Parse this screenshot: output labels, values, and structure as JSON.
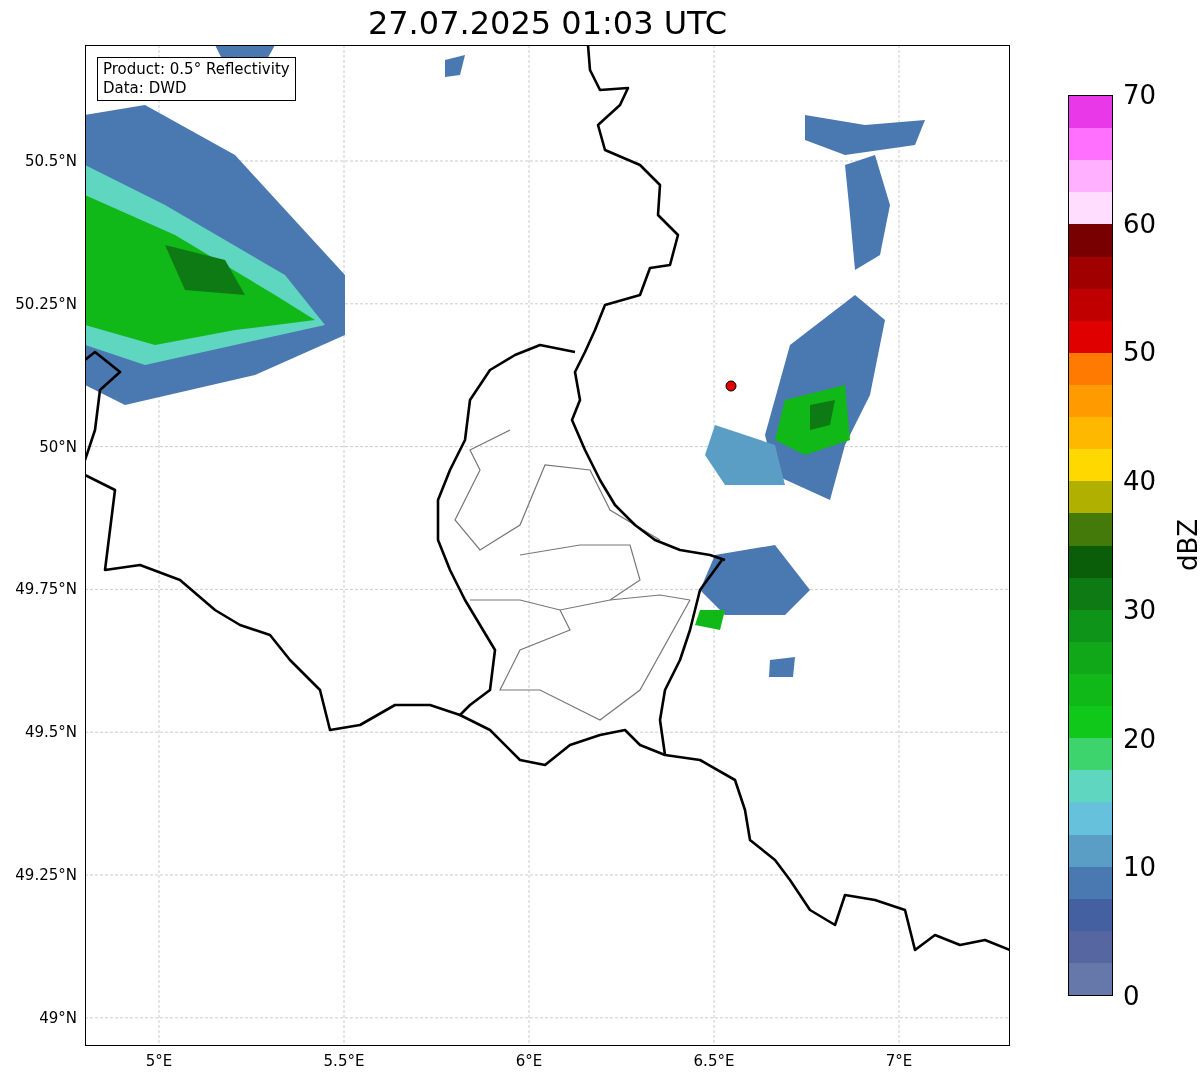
{
  "title": "27.07.2025 01:03 UTC",
  "legend": {
    "lines": [
      "Product: 0.5° Reflectivity",
      "Data: DWD"
    ]
  },
  "map": {
    "yticks": [
      "50.5°N",
      "50.25°N",
      "50°N",
      "49.75°N",
      "49.5°N",
      "49.25°N",
      "49°N"
    ],
    "xticks": [
      "5°E",
      "5.5°E",
      "6°E",
      "6.5°E",
      "7°E"
    ]
  },
  "colorbar": {
    "label": "dBZ",
    "ticks": [
      "70",
      "60",
      "50",
      "40",
      "30",
      "20",
      "10",
      "0"
    ],
    "bands": [
      {
        "color": "#6677aa"
      },
      {
        "color": "#5566a0"
      },
      {
        "color": "#4460a0"
      },
      {
        "color": "#4a78b0"
      },
      {
        "color": "#5a9ec6"
      },
      {
        "color": "#66c2dc"
      },
      {
        "color": "#5fd6c0"
      },
      {
        "color": "#3dd46e"
      },
      {
        "color": "#10c81a"
      },
      {
        "color": "#10b818"
      },
      {
        "color": "#10a818"
      },
      {
        "color": "#0e9418"
      },
      {
        "color": "#0e7a14"
      },
      {
        "color": "#0a5e0a"
      },
      {
        "color": "#447a0a"
      },
      {
        "color": "#b0b000"
      },
      {
        "color": "#ffd800"
      },
      {
        "color": "#ffb800"
      },
      {
        "color": "#ff9a00"
      },
      {
        "color": "#ff7a00"
      },
      {
        "color": "#e00000"
      },
      {
        "color": "#c00000"
      },
      {
        "color": "#a00000"
      },
      {
        "color": "#780000"
      },
      {
        "color": "#ffddff"
      },
      {
        "color": "#ffb0ff"
      },
      {
        "color": "#ff70ff"
      },
      {
        "color": "#e838e8"
      }
    ]
  }
}
